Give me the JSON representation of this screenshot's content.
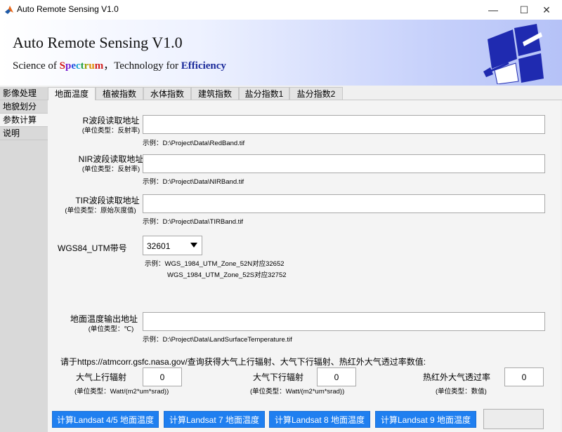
{
  "window": {
    "title": "Auto Remote Sensing V1.0",
    "minimize": "—",
    "maximize": "☐",
    "close": "✕"
  },
  "banner": {
    "title": "Auto Remote Sensing V1.0",
    "subtitle_prefix": "Science of ",
    "spectrum_letters": [
      "S",
      "p",
      "e",
      "c",
      "t",
      "r",
      "u",
      "m"
    ],
    "spectrum_colors": [
      "#d01010",
      "#7a1fd0",
      "#1f4fe0",
      "#13a0d0",
      "#20a040",
      "#9aa000",
      "#e08a00",
      "#d02020"
    ],
    "subtitle_mid": "，Technology for ",
    "subtitle_emphasis": "Efficiency",
    "emphasis_color": "#1a2a9a",
    "logo_color": "#1f2ab0"
  },
  "leftnav": {
    "items": [
      {
        "label": "影像处理"
      },
      {
        "label": "地貌划分"
      },
      {
        "label": "参数计算"
      },
      {
        "label": "说明"
      }
    ],
    "active_index": 2
  },
  "tabs": {
    "items": [
      {
        "label": "地面温度"
      },
      {
        "label": "植被指数"
      },
      {
        "label": "水体指数"
      },
      {
        "label": "建筑指数"
      },
      {
        "label": "盐分指数1"
      },
      {
        "label": "盐分指数2"
      }
    ],
    "active_index": 0
  },
  "form": {
    "r_band": {
      "label": "R波段读取地址",
      "unit": "(单位类型：反射率)",
      "value": "",
      "hint": "示例：D:\\Project\\Data\\RedBand.tif"
    },
    "nir_band": {
      "label": "NIR波段读取地址",
      "unit": "(单位类型：反射率)",
      "value": "",
      "hint": "示例：D:\\Project\\Data\\NIRBand.tif"
    },
    "tir_band": {
      "label": "TIR波段读取地址",
      "unit": "(单位类型：原始灰度值)",
      "value": "",
      "hint": "示例：D:\\Project\\Data\\TIRBand.tif"
    },
    "utm": {
      "label": "WGS84_UTM带号",
      "selected": "32601",
      "hint1": "示例：WGS_1984_UTM_Zone_52N对应32652",
      "hint2": "WGS_1984_UTM_Zone_52S对应32752"
    },
    "lst_out": {
      "label": "地面温度输出地址",
      "unit": "(单位类型：℃)",
      "value": "",
      "hint": "示例：D:\\Project\\Data\\LandSurfaceTemperature.tif"
    },
    "atm_note": "请于https://atmcorr.gsfc.nasa.gov/查询获得大气上行辐射、大气下行辐射、热红外大气透过率数值:",
    "upwelling": {
      "label": "大气上行辐射",
      "unit": "(单位类型：Watt/(m2*um*srad))",
      "value": "0"
    },
    "downwelling": {
      "label": "大气下行辐射",
      "unit": "(单位类型：Watt/(m2*um*srad))",
      "value": "0"
    },
    "transmittance": {
      "label": "热红外大气透过率",
      "unit": "(单位类型：数值)",
      "value": "0"
    }
  },
  "buttons": {
    "landsat45": "计算Landsat 4/5 地面温度",
    "landsat7": "计算Landsat 7 地面温度",
    "landsat8": "计算Landsat 8 地面温度",
    "landsat9": "计算Landsat 9 地面温度",
    "output": ""
  },
  "icons": {
    "app": "matlab-icon",
    "logo": "satellite-logo-icon",
    "dropdown": "dropdown-arrow-icon"
  }
}
